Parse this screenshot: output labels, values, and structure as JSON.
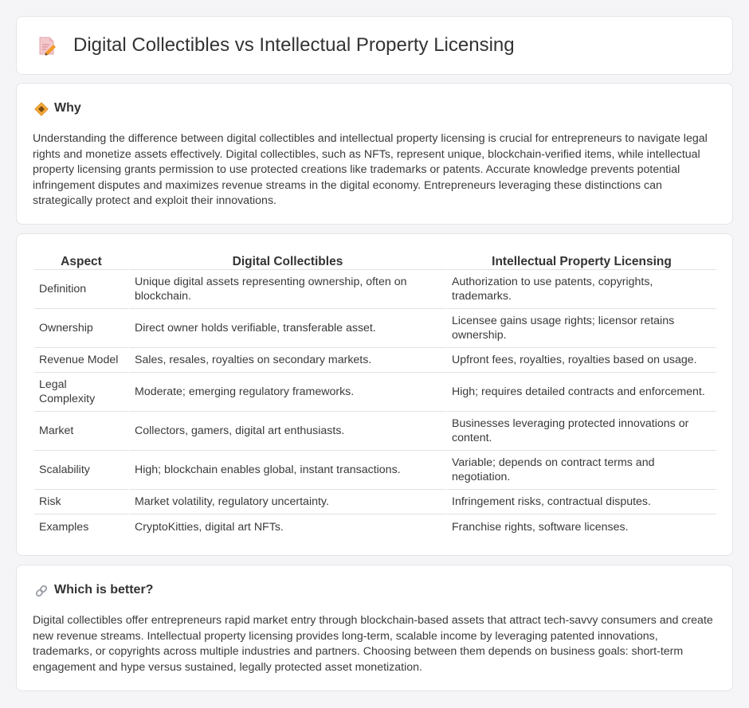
{
  "header": {
    "title": "Digital Collectibles vs Intellectual Property Licensing",
    "icon": "document-pen-icon"
  },
  "why": {
    "heading": "Why",
    "icon": "diamond-sign-icon",
    "text": "Understanding the difference between digital collectibles and intellectual property licensing is crucial for entrepreneurs to navigate legal rights and monetize assets effectively. Digital collectibles, such as NFTs, represent unique, blockchain-verified items, while intellectual property licensing grants permission to use protected creations like trademarks or patents. Accurate knowledge prevents potential infringement disputes and maximizes revenue streams in the digital economy. Entrepreneurs leveraging these distinctions can strategically protect and exploit their innovations."
  },
  "comparison": {
    "headers": [
      "Aspect",
      "Digital Collectibles",
      "Intellectual Property Licensing"
    ],
    "rows": [
      [
        "Definition",
        "Unique digital assets representing ownership, often on blockchain.",
        "Authorization to use patents, copyrights, trademarks."
      ],
      [
        "Ownership",
        "Direct owner holds verifiable, transferable asset.",
        "Licensee gains usage rights; licensor retains ownership."
      ],
      [
        "Revenue Model",
        "Sales, resales, royalties on secondary markets.",
        "Upfront fees, royalties, royalties based on usage."
      ],
      [
        "Legal Complexity",
        "Moderate; emerging regulatory frameworks.",
        "High; requires detailed contracts and enforcement."
      ],
      [
        "Market",
        "Collectors, gamers, digital art enthusiasts.",
        "Businesses leveraging protected innovations or content."
      ],
      [
        "Scalability",
        "High; blockchain enables global, instant transactions.",
        "Variable; depends on contract terms and negotiation."
      ],
      [
        "Risk",
        "Market volatility, regulatory uncertainty.",
        "Infringement risks, contractual disputes."
      ],
      [
        "Examples",
        "CryptoKitties, digital art NFTs.",
        "Franchise rights, software licenses."
      ]
    ]
  },
  "better": {
    "heading": "Which is better?",
    "icon": "link-icon",
    "text": "Digital collectibles offer entrepreneurs rapid market entry through blockchain-based assets that attract tech-savvy consumers and create new revenue streams. Intellectual property licensing provides long-term, scalable income by leveraging patented innovations, trademarks, or copyrights across multiple industries and partners. Choosing between them depends on business goals: short-term engagement and hype versus sustained, legally protected asset monetization."
  },
  "colors": {
    "page_bg": "#f5f5f7",
    "card_bg": "#ffffff",
    "border": "#e4e4e8",
    "text": "#333333",
    "icon_orange": "#f0a030",
    "icon_pink": "#f2c4c9"
  }
}
